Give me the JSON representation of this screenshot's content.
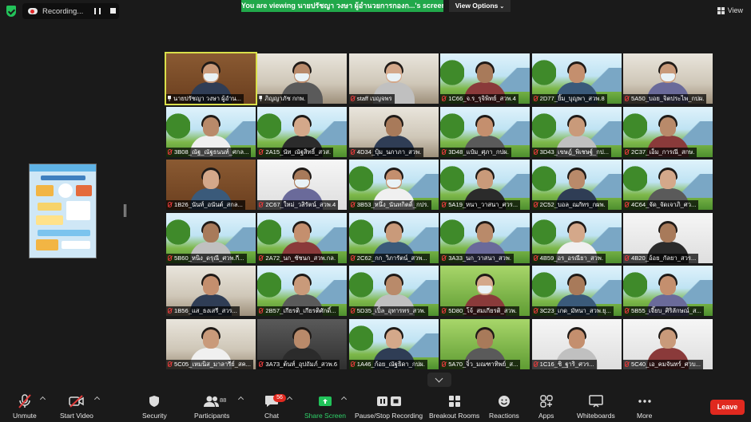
{
  "topbar": {
    "recording_label": "Recording...",
    "viewing_banner": "You are viewing นายปรัชญา วงษา ผู้อำนวยการกองก...'s screen",
    "view_options_label": "View Options",
    "view_label": "View",
    "icons": {
      "security": "shield-check-icon",
      "recording": "cloud-record-icon",
      "pause": "pause-icon",
      "stop": "stop-icon",
      "grid": "grid-icon"
    }
  },
  "participants": [
    {
      "name": "นายปรัชญา วงษา ผู้อำน...",
      "pinned": true,
      "active": true,
      "bg": "wood",
      "mask": true
    },
    {
      "name": "ภิญญาภัช กกพ.",
      "pinned": true,
      "bg": "office",
      "mask": true
    },
    {
      "name": "staff เบญจพร",
      "bg": "office",
      "mask": true
    },
    {
      "name": "1C66_จ.ร_รุจิพิทย์_สวพ.4",
      "bg": "sky"
    },
    {
      "name": "2D77_ยิ้ม_บุญพา_สวพ.8",
      "bg": "sky"
    },
    {
      "name": "5A50_บอย_จิตประไพ_กปผ.",
      "bg": "office",
      "mask": true
    },
    {
      "name": "3B08_ณัฐ_ณัฐธนนท์_ศกล...",
      "bg": "sky"
    },
    {
      "name": "2A15_นัท_ณัฐสิทธิ์_สวส.",
      "bg": "sky"
    },
    {
      "name": "4D34_ปุ้ม_นภาภา_สวพ.",
      "bg": "office"
    },
    {
      "name": "3D48_แป๋ม_ศุภา_กปผ.",
      "bg": "sky"
    },
    {
      "name": "3D43_เขษฎ์_พิเชษฐ์_กป...",
      "bg": "sky"
    },
    {
      "name": "2C37_เอ็ม_การณี_สกษ.",
      "bg": "sky"
    },
    {
      "name": "1B26_นันท์_อนันต์_สกล...",
      "bg": "wood"
    },
    {
      "name": "2C67_ใหม่_วสิรัตน์_สวพ.4",
      "bg": "white",
      "mask": true
    },
    {
      "name": "3B53_หนึ่ง_นันทกิตติ์_กปร.",
      "bg": "sky",
      "mask": true
    },
    {
      "name": "5A19_หนา_วาสนา_ศวร...",
      "bg": "sky"
    },
    {
      "name": "2C52_บอล_ณภัทร_กผพ.",
      "bg": "sky"
    },
    {
      "name": "4C64_จัด_จัดเจาภิ_ศว...",
      "bg": "sky"
    },
    {
      "name": "5B60_หนิง_ดรุณี_ศวพ.กี...",
      "bg": "sky"
    },
    {
      "name": "2A72_นก_ชัชนก_สวพ.กล.",
      "bg": "sky"
    },
    {
      "name": "2C62_กก_วิภารัตน์_สวพ...",
      "bg": "sky"
    },
    {
      "name": "3A33_นก_วาสนา_สวพ.",
      "bg": "sky"
    },
    {
      "name": "4B59_อร_อรณียา_สวพ.",
      "bg": "sky"
    },
    {
      "name": "4B20_อ้อย_กัลยา_สวร...",
      "bg": "white"
    },
    {
      "name": "1B56_แส_ธงเสรี_สวร...",
      "bg": "office"
    },
    {
      "name": "2B57_เกียรติ_เกียรติศักดิ์...",
      "bg": "sky"
    },
    {
      "name": "5D35_เปิ้ล_อุทารทร_สวพ.",
      "bg": "sky"
    },
    {
      "name": "5D80_โจ้_สมเกียรติ_สวพ.",
      "bg": "green",
      "mask": true
    },
    {
      "name": "3C23_เกด_มัทนา_สวพ.ยุ...",
      "bg": "sky"
    },
    {
      "name": "5B55_เจี๊ยบ_ศิริลักษณ์_ส...",
      "bg": "sky"
    },
    {
      "name": "5C05_เหมนิส_มาลารีย์_สค...",
      "bg": "office"
    },
    {
      "name": "3A73_ต้นท์_อุปถัมภ์_สวพ.6",
      "bg": "dark"
    },
    {
      "name": "1A46_ก้อย_ณัฐธิดา_กปผ.",
      "bg": "sky"
    },
    {
      "name": "5A70_จิ๋ว_มณฑาทิพย์_ส...",
      "bg": "green"
    },
    {
      "name": "1C16_ชิ_ฐาริ_ศวร...",
      "bg": "white"
    },
    {
      "name": "5C40_เอ_คมจันทร์_ศวบ...",
      "bg": "white"
    }
  ],
  "toolbar": {
    "unmute": "Unmute",
    "start_video": "Start Video",
    "security": "Security",
    "participants": "Participants",
    "participants_count": "88",
    "chat": "Chat",
    "chat_badge": "56",
    "share_screen": "Share Screen",
    "pause_recording": "Pause/Stop Recording",
    "breakout_rooms": "Breakout Rooms",
    "reactions": "Reactions",
    "apps": "Apps",
    "whiteboards": "Whiteboards",
    "more": "More",
    "leave": "Leave"
  },
  "colors": {
    "background": "#1a1a1a",
    "share_green": "#21a84a",
    "leave_red": "#e0291f",
    "active_speaker": "#d9df4a",
    "muted_red": "#e23a3a"
  }
}
